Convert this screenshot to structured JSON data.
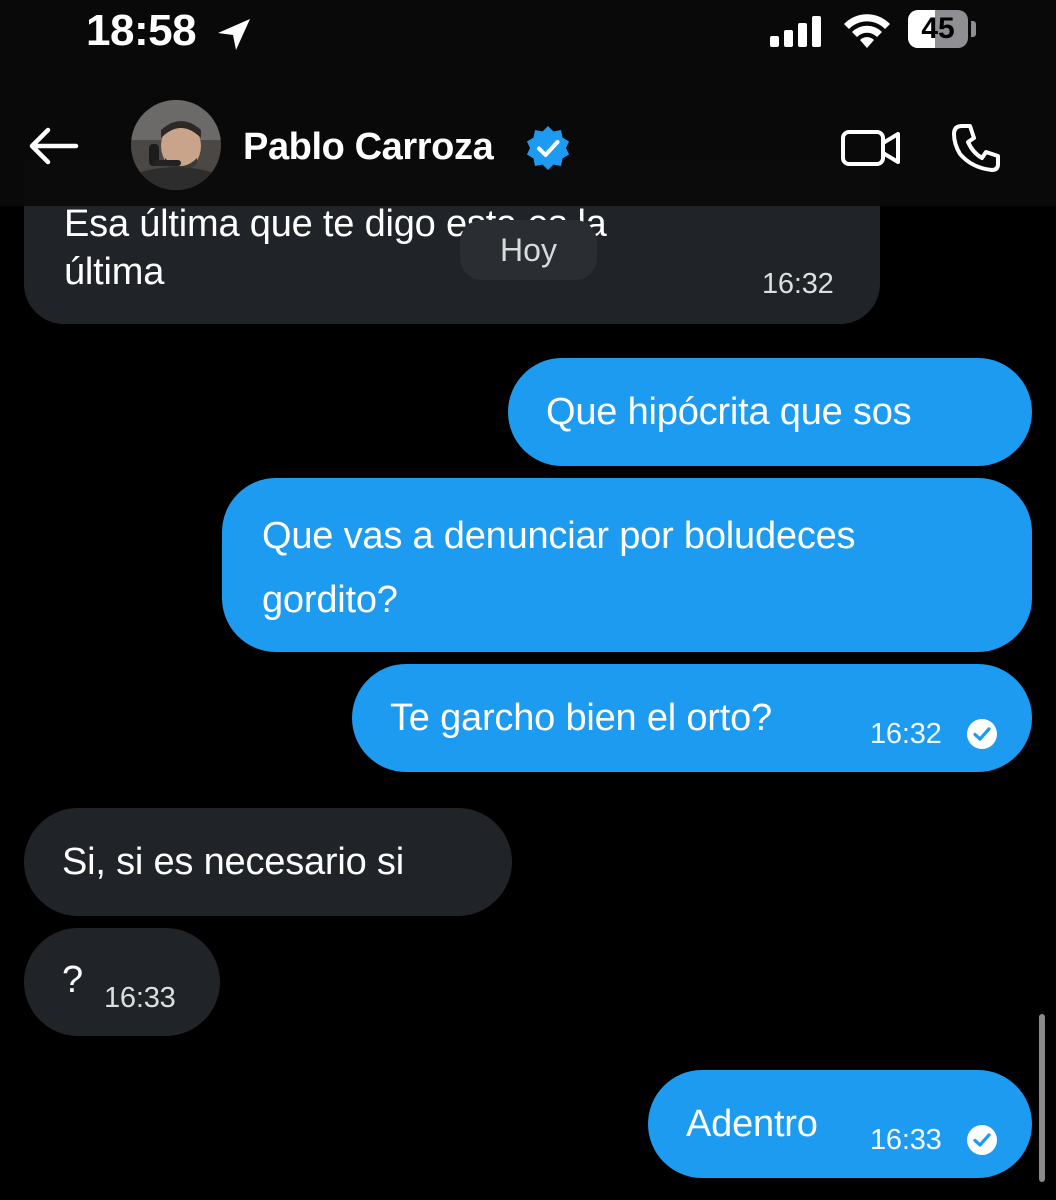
{
  "status_bar": {
    "time": "18:58",
    "battery_level": "45",
    "battery_fraction": 0.45,
    "icons": [
      "location-arrow-icon",
      "cellular-signal-icon",
      "wifi-icon",
      "battery-icon"
    ]
  },
  "header": {
    "contact_name": "Pablo Carroza",
    "verified": true,
    "icons": [
      "back-arrow-icon",
      "verified-badge-icon",
      "video-call-icon",
      "phone-call-icon"
    ]
  },
  "day_separator": "Hoy",
  "messages": [
    {
      "direction": "in",
      "partial_text": "Esa última que te digo esta es la",
      "text": "última",
      "time": "16:32"
    },
    {
      "direction": "out",
      "text": "Que hipócrita que sos"
    },
    {
      "direction": "out",
      "text_line1": "Que vas a denunciar por boludeces",
      "text_line2": "gordito?"
    },
    {
      "direction": "out",
      "text": "Te garcho bien el orto?",
      "time": "16:32",
      "read": true
    },
    {
      "direction": "in",
      "text": "Si, si es necesario si"
    },
    {
      "direction": "in",
      "text": "?",
      "time": "16:33"
    },
    {
      "direction": "out",
      "text": "Adentro",
      "time": "16:33",
      "read": true
    }
  ],
  "colors": {
    "outgoing_bubble": "#1d9bf0",
    "incoming_bubble": "#202327",
    "background": "#000000",
    "verified_badge": "#1d9bf0"
  }
}
